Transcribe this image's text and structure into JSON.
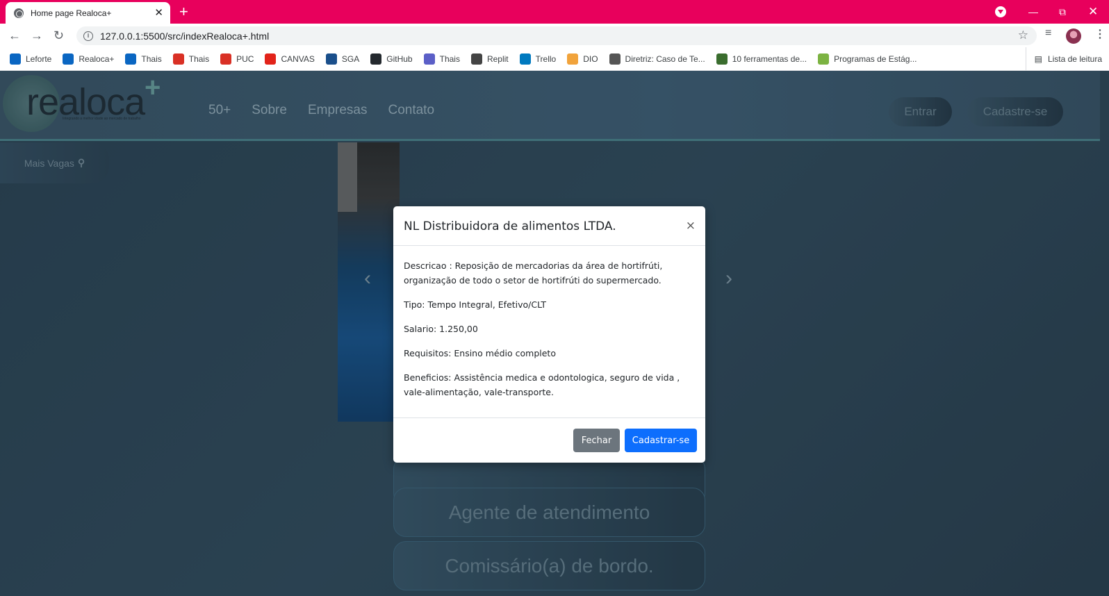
{
  "browser": {
    "tab_title": "Home page Realoca+",
    "tab_close": "✕",
    "new_tab": "+",
    "url": "127.0.0.1:5500/src/indexRealoca+.html",
    "bookmarks": [
      {
        "label": "Leforte",
        "color": "#0a66c2"
      },
      {
        "label": "Realoca+",
        "color": "#0a66c2"
      },
      {
        "label": "Thais",
        "color": "#0a66c2"
      },
      {
        "label": "Thais",
        "color": "#d93025"
      },
      {
        "label": "PUC",
        "color": "#d93025"
      },
      {
        "label": "CANVAS",
        "color": "#e2231a"
      },
      {
        "label": "SGA",
        "color": "#1a4f8b"
      },
      {
        "label": "GitHub",
        "color": "#24292e"
      },
      {
        "label": "Thais",
        "color": "#5b5fc7"
      },
      {
        "label": "Replit",
        "color": "#444"
      },
      {
        "label": "Trello",
        "color": "#0079bf"
      },
      {
        "label": "DIO",
        "color": "#f1a33b"
      },
      {
        "label": "Diretriz: Caso de Te...",
        "color": "#555"
      },
      {
        "label": "10 ferramentas de...",
        "color": "#3a6d2e"
      },
      {
        "label": "Programas de Estág...",
        "color": "#7cb342"
      }
    ],
    "reading_list": "Lista de leitura"
  },
  "site": {
    "logo_text": "realoca",
    "logo_plus": "+",
    "logo_tagline": "Integrando a melhor idade ao mercado de trabalho",
    "nav": [
      "50+",
      "Sobre",
      "Empresas",
      "Contato"
    ],
    "login": "Entrar",
    "signup": "Cadastre-se",
    "more_jobs": "Mais Vagas",
    "job_cards": [
      "Agente de atendimento",
      "Comissário(a) de bordo."
    ]
  },
  "modal": {
    "title": "NL Distribuidora de alimentos LTDA.",
    "close": "×",
    "description": "Descricao : Reposição de mercadorias da área de hortifrúti, organização de todo o setor de hortifrúti do supermercado.",
    "type": "Tipo: Tempo Integral, Efetivo/CLT",
    "salary": "Salario: 1.250,00",
    "requirements": "Requisitos: Ensino médio completo",
    "benefits": "Beneficios: Assistência medica e odontologica, seguro de vida , vale-alimentação, vale-transporte.",
    "close_button": "Fechar",
    "apply_button": "Cadastrar-se"
  }
}
